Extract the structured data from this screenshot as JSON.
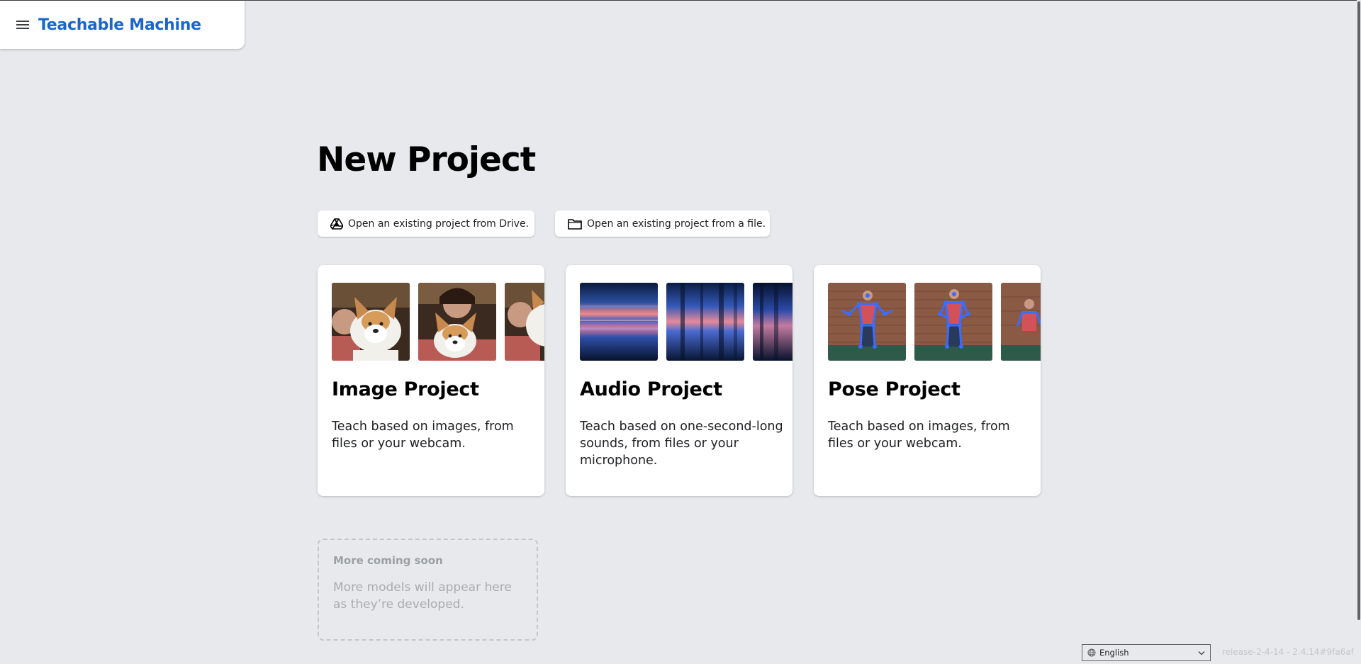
{
  "app": {
    "title": "Teachable Machine",
    "menu_icon": "hamburger-menu-icon"
  },
  "page": {
    "heading": "New Project"
  },
  "actions": {
    "drive_label": "Open an existing project from Drive.",
    "drive_icon": "google-drive-icon",
    "file_label": "Open an existing project from a file.",
    "file_icon": "folder-icon"
  },
  "projects": [
    {
      "title": "Image Project",
      "description": "Teach based on images, from files or your webcam.",
      "thumbnail_kind": "webcam photos of person with plush corgi"
    },
    {
      "title": "Audio Project",
      "description": "Teach based on one-second-long sounds, from files or your microphone.",
      "thumbnail_kind": "audio spectrograms"
    },
    {
      "title": "Pose Project",
      "description": "Teach based on images, from files or your webcam.",
      "thumbnail_kind": "person with pose skeleton overlay"
    }
  ],
  "coming_soon": {
    "title": "More coming soon",
    "description": "More models will appear here as they’re developed."
  },
  "footer": {
    "language": "English",
    "language_icon": "globe-icon",
    "release": "release-2-4-14 - 2.4.14#9fa6af"
  },
  "colors": {
    "background": "#e8e9ec",
    "brand_blue": "#1a66c9",
    "card": "#ffffff"
  }
}
